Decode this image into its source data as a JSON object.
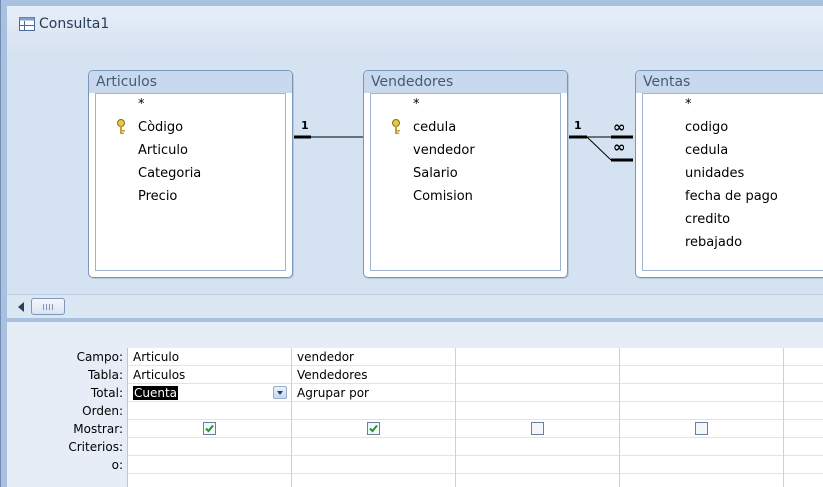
{
  "window": {
    "title": "Consulta1"
  },
  "tables": [
    {
      "name": "Articulos",
      "fields": [
        "*",
        "Còdigo",
        "Articulo",
        "Categoria",
        "Precio"
      ],
      "key_field": "Còdigo"
    },
    {
      "name": "Vendedores",
      "fields": [
        "*",
        "cedula",
        "vendedor",
        "Salario",
        "Comision"
      ],
      "key_field": "cedula"
    },
    {
      "name": "Ventas",
      "fields": [
        "*",
        "codigo",
        "cedula",
        "unidades",
        "fecha de pago",
        "credito",
        "rebajado"
      ]
    }
  ],
  "relationships": [
    {
      "from": "Articulos",
      "to": "Vendedores",
      "label_left": "1"
    },
    {
      "from": "Vendedores",
      "to": "Ventas",
      "label_left": "1",
      "label_right_1": "∞",
      "label_right_2": "∞"
    }
  ],
  "grid": {
    "row_labels": [
      "Campo:",
      "Tabla:",
      "Total:",
      "Orden:",
      "Mostrar:",
      "Criterios:",
      "o:"
    ],
    "columns": [
      {
        "campo": "Articulo",
        "tabla": "Articulos",
        "total": "Cuenta",
        "orden": "",
        "mostrar": true
      },
      {
        "campo": "vendedor",
        "tabla": "Vendedores",
        "total": "Agrupar por",
        "orden": "",
        "mostrar": true
      },
      {
        "campo": "",
        "tabla": "",
        "total": "",
        "orden": "",
        "mostrar": false
      },
      {
        "campo": "",
        "tabla": "",
        "total": "",
        "orden": "",
        "mostrar": false
      }
    ]
  },
  "icons": {
    "window": "query-icon",
    "key": "primary-key-icon",
    "scroll_left": "scroll-left-arrow-icon",
    "dropdown": "chevron-down-icon",
    "checkbox": "checkbox-icon"
  },
  "colors": {
    "frame": "#a9c1de",
    "pane": "#d5e2f1",
    "table_header": "#c9d9ed",
    "checkbox_check": "#1f9a2a"
  }
}
